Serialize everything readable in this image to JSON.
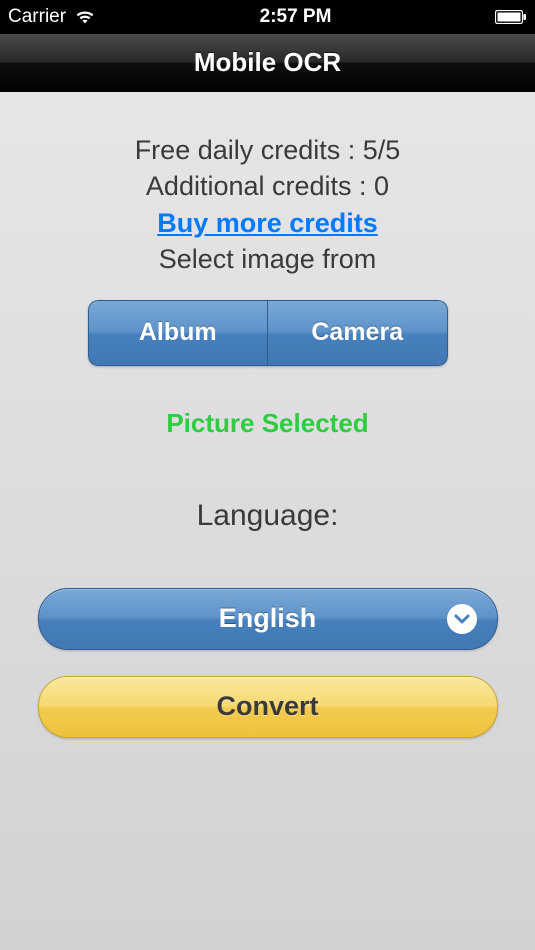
{
  "status_bar": {
    "carrier": "Carrier",
    "time": "2:57 PM"
  },
  "nav": {
    "title": "Mobile OCR"
  },
  "credits": {
    "free_line": "Free daily credits : 5/5",
    "additional_line": "Additional credits : 0",
    "buy_link": "Buy more credits"
  },
  "source": {
    "label": "Select image from",
    "album": "Album",
    "camera": "Camera"
  },
  "status_text": "Picture Selected",
  "language": {
    "label": "Language:",
    "selected": "English"
  },
  "convert": {
    "label": "Convert"
  }
}
